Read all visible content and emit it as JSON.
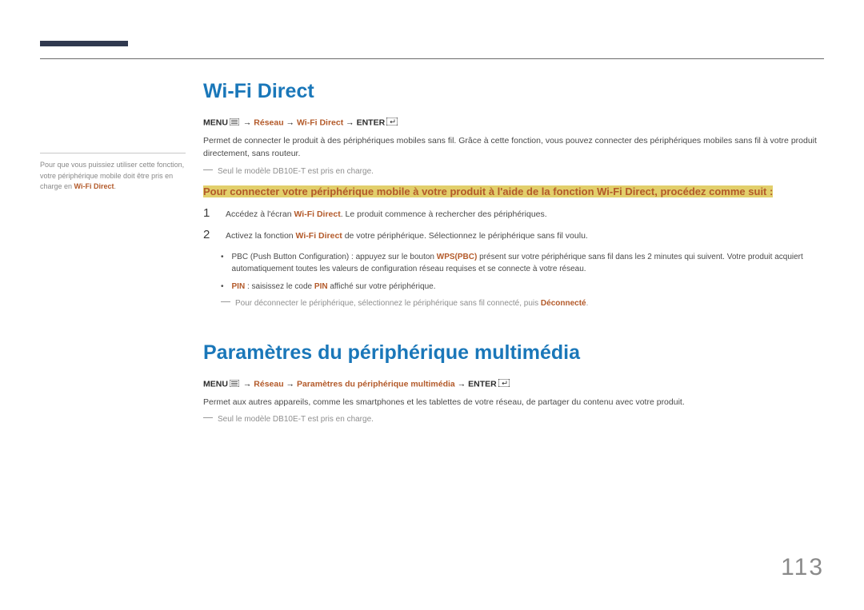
{
  "page_number": "113",
  "sidebar": {
    "note_pre": "Pour que vous puissiez utiliser cette fonction, votre périphérique mobile doit être pris en charge en ",
    "note_accent": "Wi-Fi Direct",
    "note_post": "."
  },
  "section1": {
    "title": "Wi-Fi Direct",
    "path": {
      "menu": "MENU",
      "arrow": " → ",
      "p1": "Réseau",
      "p2": "Wi-Fi Direct",
      "enter": "ENTER"
    },
    "intro": "Permet de connecter le produit à des périphériques mobiles sans fil. Grâce à cette fonction, vous pouvez connecter des périphériques mobiles sans fil à votre produit directement, sans routeur.",
    "note1": "Seul le modèle DB10E-T est pris en charge.",
    "highlight": "Pour connecter votre périphérique mobile à votre produit à l'aide de la fonction Wi-Fi Direct, procédez comme suit :",
    "steps": [
      {
        "num": "1",
        "pre": "Accédez à l'écran ",
        "accent": "Wi-Fi Direct",
        "post": ". Le produit commence à rechercher des périphériques."
      },
      {
        "num": "2",
        "pre": "Activez la fonction ",
        "accent": "Wi-Fi Direct",
        "post": " de votre périphérique. Sélectionnez le périphérique sans fil voulu."
      }
    ],
    "bullets": [
      {
        "pre": "PBC (Push Button Configuration) : appuyez sur le bouton ",
        "accent": "WPS(PBC)",
        "post": " présent sur votre périphérique sans fil dans les 2 minutes qui suivent. Votre produit acquiert automatiquement toutes les valeurs de configuration réseau requises et se connecte à votre réseau."
      },
      {
        "accent": "PIN",
        "pre2": " : saisissez le code ",
        "accent2": "PIN",
        "post": " affiché sur votre périphérique."
      }
    ],
    "note2_pre": "Pour déconnecter le périphérique, sélectionnez le périphérique sans fil connecté, puis ",
    "note2_accent": "Déconnecté",
    "note2_post": "."
  },
  "section2": {
    "title": "Paramètres du périphérique multimédia",
    "path": {
      "menu": "MENU",
      "arrow": " → ",
      "p1": "Réseau",
      "p2": "Paramètres du périphérique multimédia",
      "enter": "ENTER"
    },
    "body": "Permet aux autres appareils, comme les smartphones et les tablettes de votre réseau, de partager du contenu avec votre produit.",
    "note1": "Seul le modèle DB10E-T est pris en charge."
  }
}
